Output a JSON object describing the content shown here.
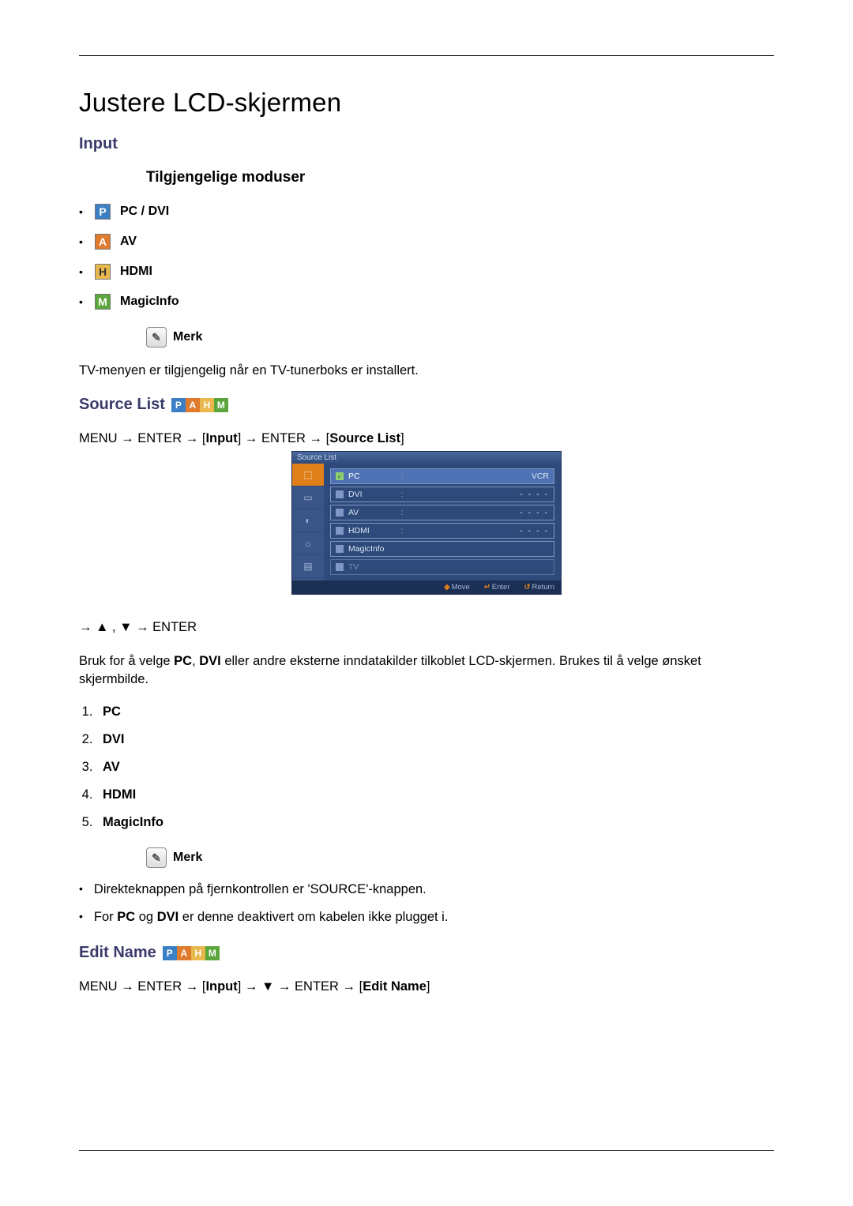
{
  "title": "Justere LCD-skjermen",
  "sections": {
    "input": {
      "heading": "Input",
      "modes_heading": "Tilgjengelige moduser",
      "modes": [
        {
          "icon": "P",
          "label": "PC / DVI"
        },
        {
          "icon": "A",
          "label": "AV"
        },
        {
          "icon": "H",
          "label": "HDMI"
        },
        {
          "icon": "M",
          "label": "MagicInfo"
        }
      ],
      "note_label": "Merk",
      "note_text": "TV-menyen er tilgjengelig når en TV-tunerboks er installert."
    },
    "source_list": {
      "heading": "Source List",
      "path_pre": "MENU → ENTER → [",
      "path_input": "Input",
      "path_mid": "] → ENTER → [",
      "path_src": "Source List",
      "path_post": "]",
      "osd": {
        "title": "Source List",
        "rows": [
          {
            "name": "PC",
            "value": "VCR",
            "selected": true,
            "checked": true
          },
          {
            "name": "DVI",
            "value": "- - - -"
          },
          {
            "name": "AV",
            "value": "- - - -"
          },
          {
            "name": "HDMI",
            "value": "- - - -"
          },
          {
            "name": "MagicInfo",
            "value": ""
          },
          {
            "name": "TV",
            "value": "",
            "disabled": true
          }
        ],
        "foot": {
          "move": "Move",
          "enter": "Enter",
          "ret": "Return"
        }
      },
      "arrows_line": "→ ▲ , ▼ → ENTER",
      "desc_pre": "Bruk for å velge ",
      "desc_pc": "PC",
      "desc_comma": ", ",
      "desc_dvi": "DVI",
      "desc_post": " eller andre eksterne inndatakilder tilkoblet LCD-skjermen. Brukes til å velge ønsket skjermbilde.",
      "items": [
        "PC",
        "DVI",
        "AV",
        "HDMI",
        "MagicInfo"
      ],
      "note_label": "Merk",
      "notes": {
        "n1": "Direkteknappen på fjernkontrollen er 'SOURCE'-knappen.",
        "n2_pre": "For ",
        "n2_pc": "PC",
        "n2_and": " og ",
        "n2_dvi": "DVI",
        "n2_post": " er denne deaktivert om kabelen ikke plugget i."
      }
    },
    "edit_name": {
      "heading": "Edit Name",
      "path_pre": "MENU → ENTER → [",
      "path_input": "Input",
      "path_mid": "] → ▼ → ENTER → [",
      "path_en": "Edit Name",
      "path_post": "]"
    }
  }
}
